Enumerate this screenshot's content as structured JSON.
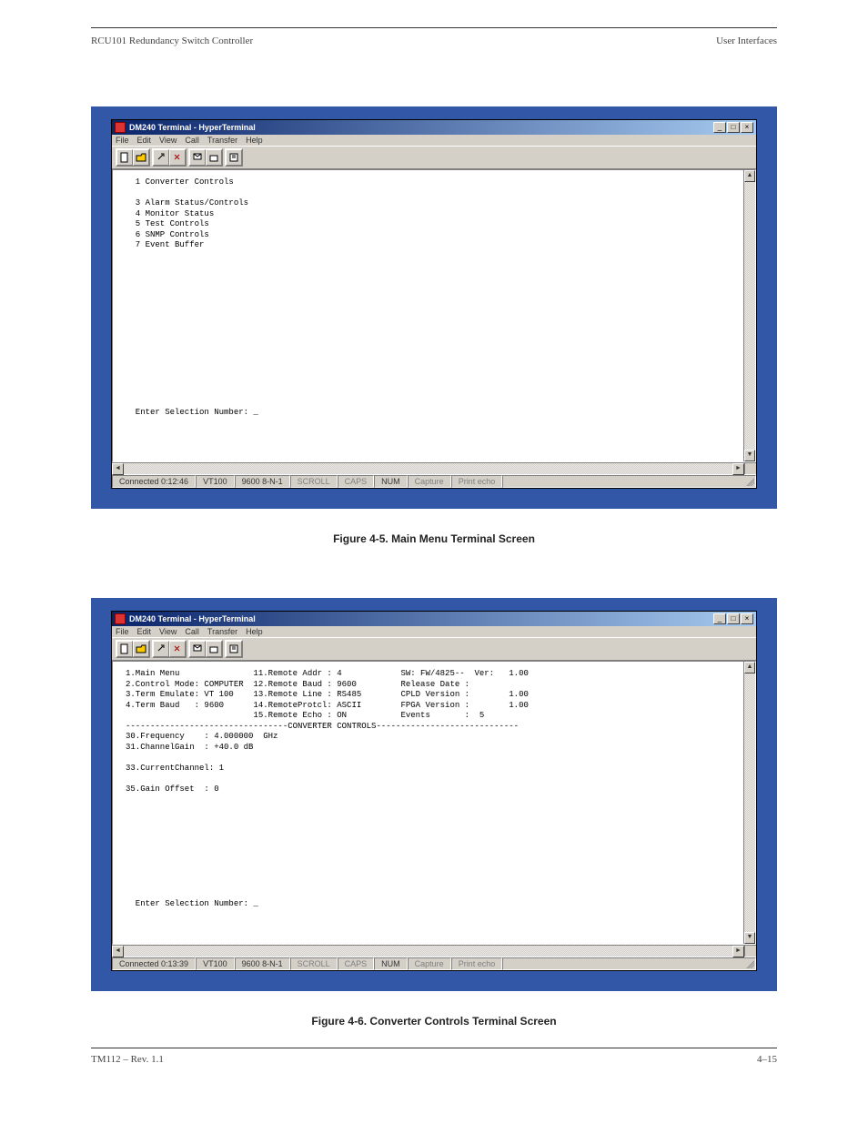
{
  "doc": {
    "header_left": "RCU101 Redundancy Switch Controller",
    "header_right": "User Interfaces",
    "footer_left": "TM112 – Rev. 1.1",
    "footer_right": "4–15"
  },
  "fig1": {
    "caption": "Figure 4-5.  Main Menu Terminal Screen",
    "title": "DM240 Terminal - HyperTerminal",
    "menu": {
      "m0": "File",
      "m1": "Edit",
      "m2": "View",
      "m3": "Call",
      "m4": "Transfer",
      "m5": "Help"
    },
    "content": "  1 Converter Controls\n\n  3 Alarm Status/Controls\n  4 Monitor Status\n  5 Test Controls\n  6 SNMP Controls\n  7 Event Buffer\n\n\n\n\n\n\n\n\n\n\n\n\n\n\n\n  Enter Selection Number: _",
    "status": {
      "s0": "Connected 0:12:46",
      "s1": "VT100",
      "s2": "9600 8-N-1",
      "s3": "SCROLL",
      "s4": "CAPS",
      "s5": "NUM",
      "s6": "Capture",
      "s7": "Print echo"
    }
  },
  "fig2": {
    "caption": "Figure 4-6.  Converter Controls Terminal Screen",
    "title": "DM240 Terminal - HyperTerminal",
    "menu": {
      "m0": "File",
      "m1": "Edit",
      "m2": "View",
      "m3": "Call",
      "m4": "Transfer",
      "m5": "Help"
    },
    "content": "1.Main Menu               11.Remote Addr : 4            SW: FW/4825--  Ver:   1.00\n2.Control Mode: COMPUTER  12.Remote Baud : 9600         Release Date :\n3.Term Emulate: VT 100    13.Remote Line : RS485        CPLD Version :        1.00\n4.Term Baud   : 9600      14.RemoteProtcl: ASCII        FPGA Version :        1.00\n                          15.Remote Echo : ON           Events       :  5\n---------------------------------CONVERTER CONTROLS-----------------------------\n30.Frequency    : 4.000000  GHz\n31.ChannelGain  : +40.0 dB\n\n33.CurrentChannel: 1\n\n35.Gain Offset  : 0\n\n\n\n\n\n\n\n\n\n\n  Enter Selection Number: _",
    "status": {
      "s0": "Connected 0:13:39",
      "s1": "VT100",
      "s2": "9600 8-N-1",
      "s3": "SCROLL",
      "s4": "CAPS",
      "s5": "NUM",
      "s6": "Capture",
      "s7": "Print echo"
    }
  },
  "icons": {
    "min": "_",
    "max": "□",
    "close": "×",
    "up": "▲",
    "down": "▼",
    "left": "◄",
    "right": "►"
  }
}
